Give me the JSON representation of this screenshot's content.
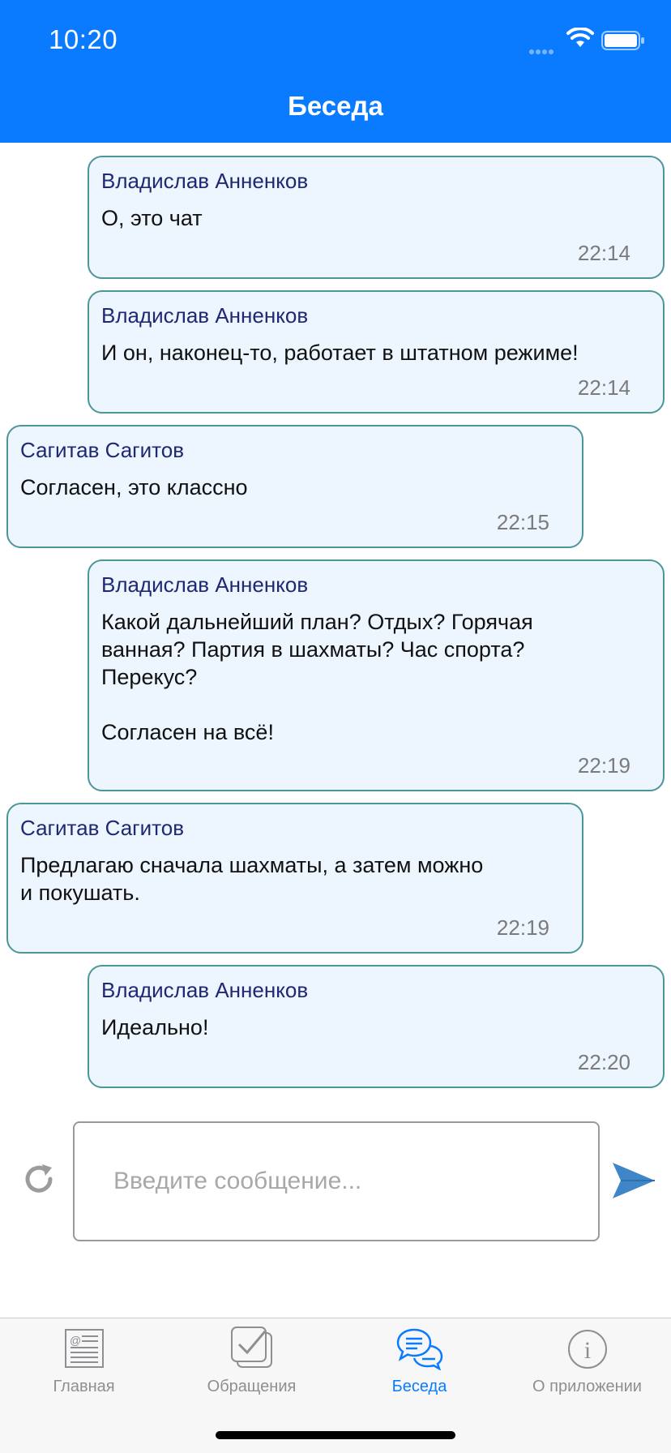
{
  "status_bar": {
    "time": "10:20"
  },
  "nav": {
    "title": "Беседа"
  },
  "messages": [
    {
      "sender": "Владислав Анненков",
      "text": "О, это чат",
      "time": "22:14",
      "mine": true
    },
    {
      "sender": "Владислав Анненков",
      "text": "И он, наконец-то, работает в штатном режиме!",
      "time": "22:14",
      "mine": true
    },
    {
      "sender": "Сагитав Сагитов",
      "text": "Согласен, это классно",
      "time": "22:15",
      "mine": false
    },
    {
      "sender": "Владислав Анненков",
      "text": "Какой дальнейший план? Отдых? Горячая\nванная? Партия в шахматы? Час спорта?\nПерекус?\n\nСогласен на всё!",
      "time": "22:19",
      "mine": true
    },
    {
      "sender": "Сагитав Сагитов",
      "text": "Предлагаю сначала шахматы, а затем можно\nи покушать.",
      "time": "22:19",
      "mine": false
    },
    {
      "sender": "Владислав Анненков",
      "text": "Идеально!",
      "time": "22:20",
      "mine": true
    }
  ],
  "composer": {
    "placeholder": "Введите сообщение...",
    "value": ""
  },
  "tabs": [
    {
      "label": "Главная",
      "icon": "newspaper-icon",
      "active": false
    },
    {
      "label": "Обращения",
      "icon": "checkbox-icon",
      "active": false
    },
    {
      "label": "Беседа",
      "icon": "chat-bubbles-icon",
      "active": true
    },
    {
      "label": "О приложении",
      "icon": "info-icon",
      "active": false
    }
  ],
  "colors": {
    "accent": "#0a7bff",
    "bubble_bg": "#edf5ff",
    "bubble_border": "#4a9896",
    "sender": "#1f2873"
  }
}
